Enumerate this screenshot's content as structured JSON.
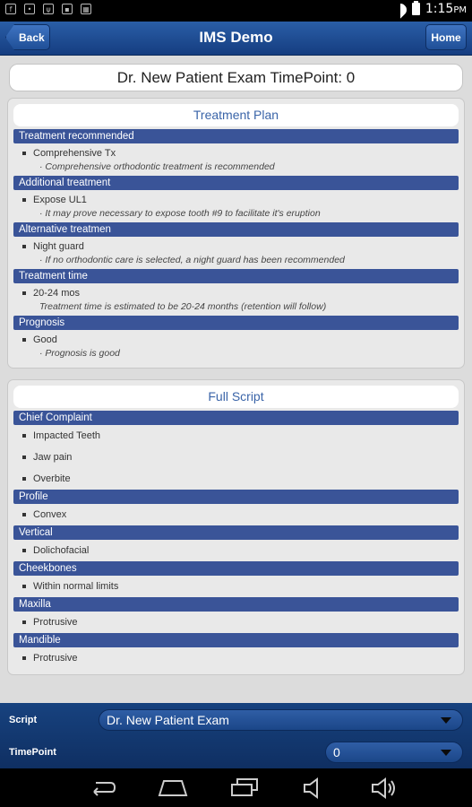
{
  "status_bar": {
    "time": "1:15",
    "time_suffix": "PM"
  },
  "nav": {
    "back_label": "Back",
    "title": "IMS Demo",
    "home_label": "Home"
  },
  "page_heading": "Dr. New Patient Exam TimePoint: 0",
  "treatment_plan": {
    "title": "Treatment Plan",
    "sections": [
      {
        "heading": "Treatment recommended",
        "item": "Comprehensive Tx",
        "note": "· Comprehensive orthodontic treatment is recommended"
      },
      {
        "heading": "Additional treatment",
        "item": "Expose UL1",
        "note": "· It may prove necessary to expose tooth #9 to facilitate it's eruption"
      },
      {
        "heading": "Alternative treatmen",
        "item": "Night guard",
        "note": "· If no orthodontic care is selected, a night guard has been recommended"
      },
      {
        "heading": "Treatment time",
        "item": "20-24 mos",
        "note": "Treatment time is estimated to be 20-24 months (retention will follow)"
      },
      {
        "heading": "Prognosis",
        "item": "Good",
        "note": "· Prognosis is good"
      }
    ]
  },
  "full_script": {
    "title": "Full Script",
    "chief_complaint": {
      "heading": "Chief Complaint",
      "items": [
        "Impacted Teeth",
        "Jaw pain",
        "Overbite"
      ]
    },
    "profile": {
      "heading": "Profile",
      "item": "Convex"
    },
    "vertical": {
      "heading": "Vertical",
      "item": "Dolichofacial"
    },
    "cheekbones": {
      "heading": "Cheekbones",
      "item": "Within normal limits"
    },
    "maxilla": {
      "heading": "Maxilla",
      "item": "Protrusive"
    },
    "mandible": {
      "heading": "Mandible",
      "item": "Protrusive"
    }
  },
  "controls": {
    "script_label": "Script",
    "script_value": "Dr. New Patient Exam",
    "timepoint_label": "TimePoint",
    "timepoint_value": "0"
  },
  "colors": {
    "nav_blue": "#1f4f97",
    "section_head": "#3a5498",
    "panel_title_text": "#3a64a8"
  }
}
